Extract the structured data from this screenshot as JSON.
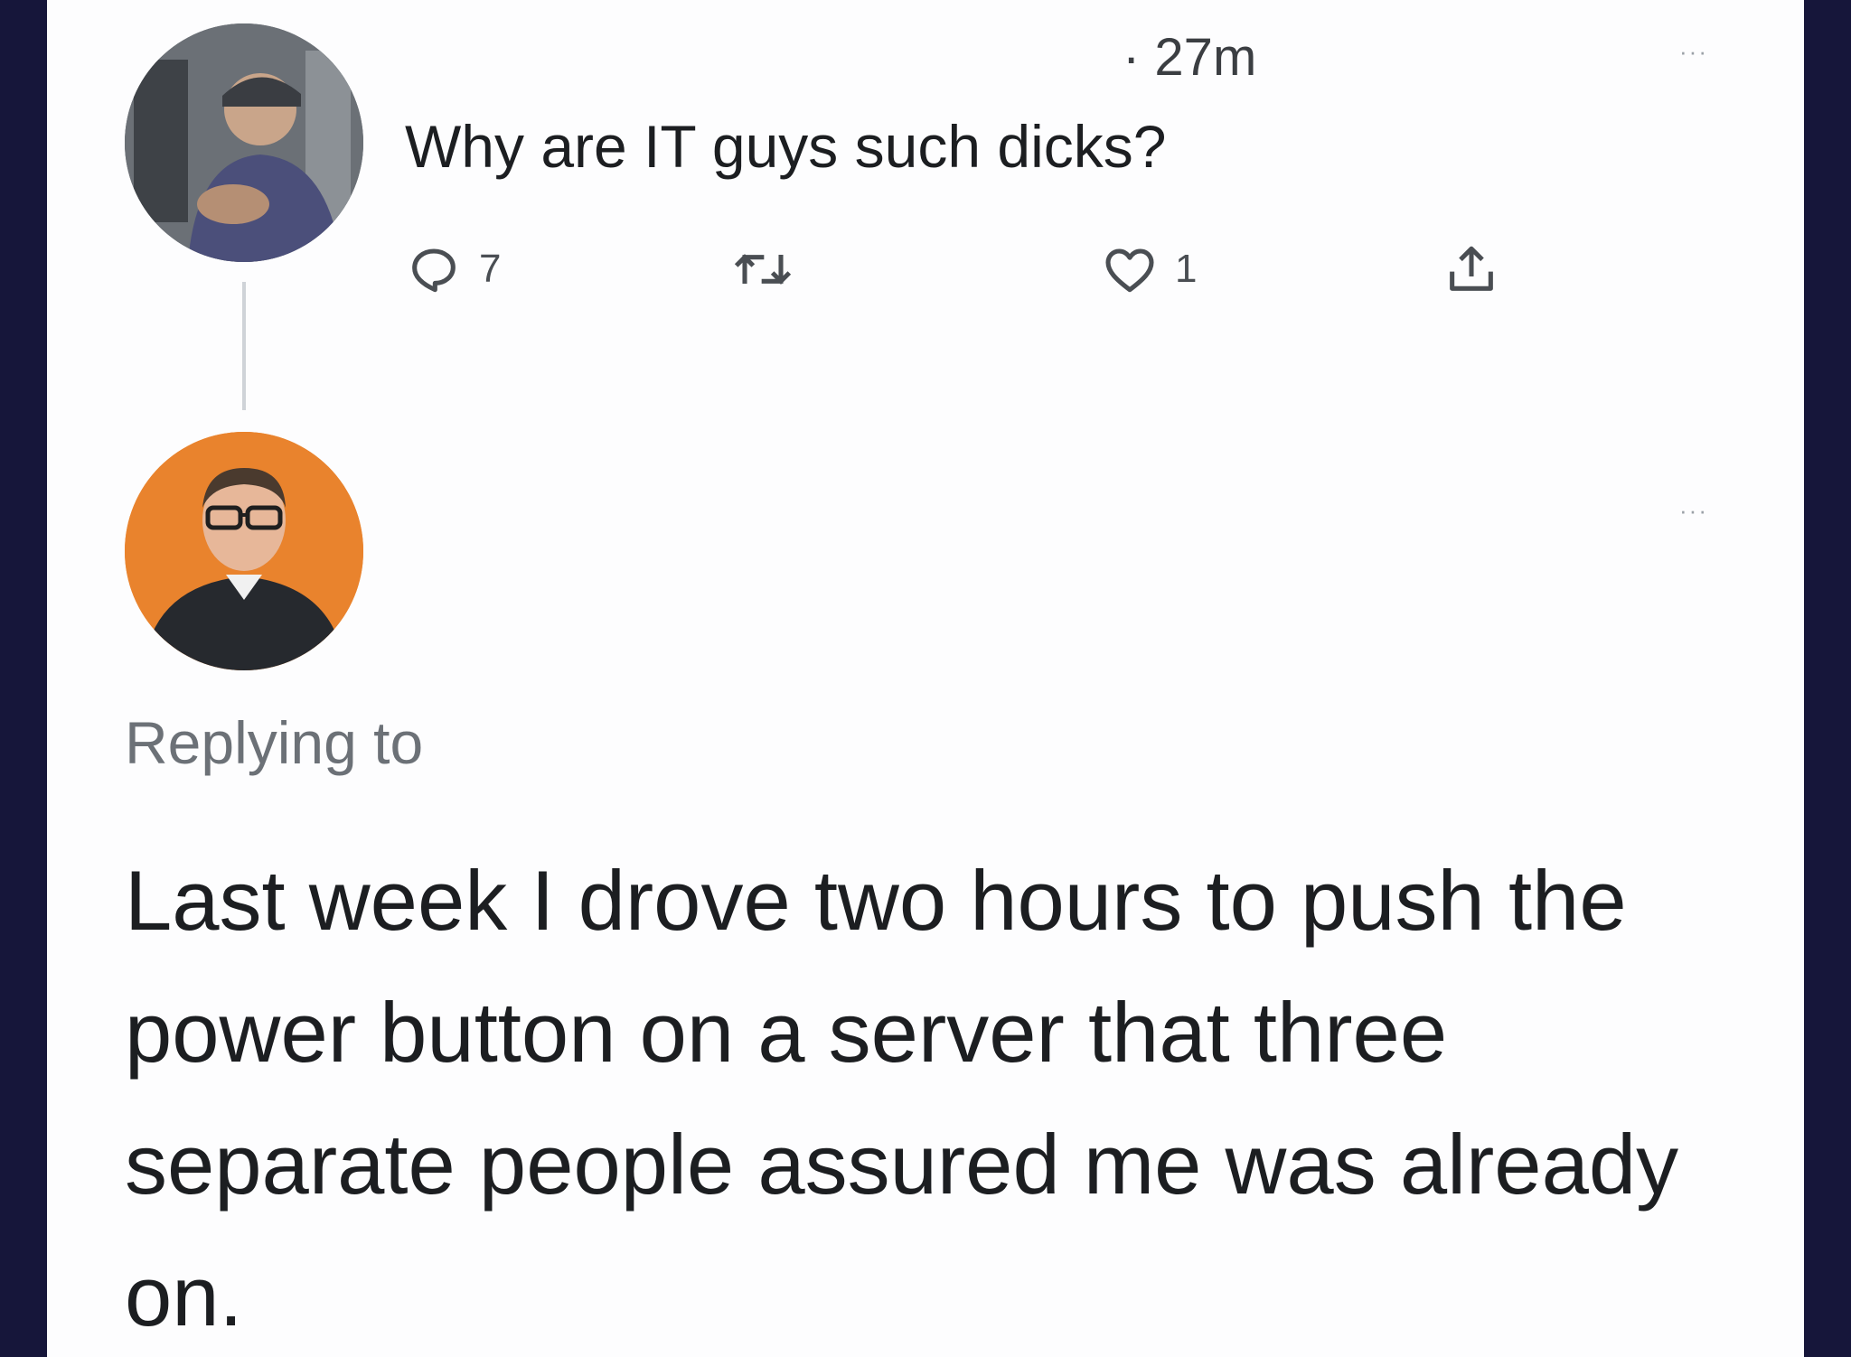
{
  "original_tweet": {
    "timestamp": "· 27m",
    "more_label": "···",
    "text": "Why are IT guys such dicks?",
    "reply_count": "7",
    "like_count": "1",
    "icons": {
      "reply": "comment-bubble-icon",
      "retweet": "retweet-icon",
      "like": "heart-icon",
      "share": "share-icon"
    }
  },
  "reply_tweet": {
    "more_label": "···",
    "replying_label": "Replying to",
    "text": "Last week I drove two hours to push the power button on a server that three separate people assured me was already on."
  },
  "colors": {
    "background": "#16163a",
    "card": "#fdfdfe",
    "avatar_orange": "#e9832d"
  }
}
